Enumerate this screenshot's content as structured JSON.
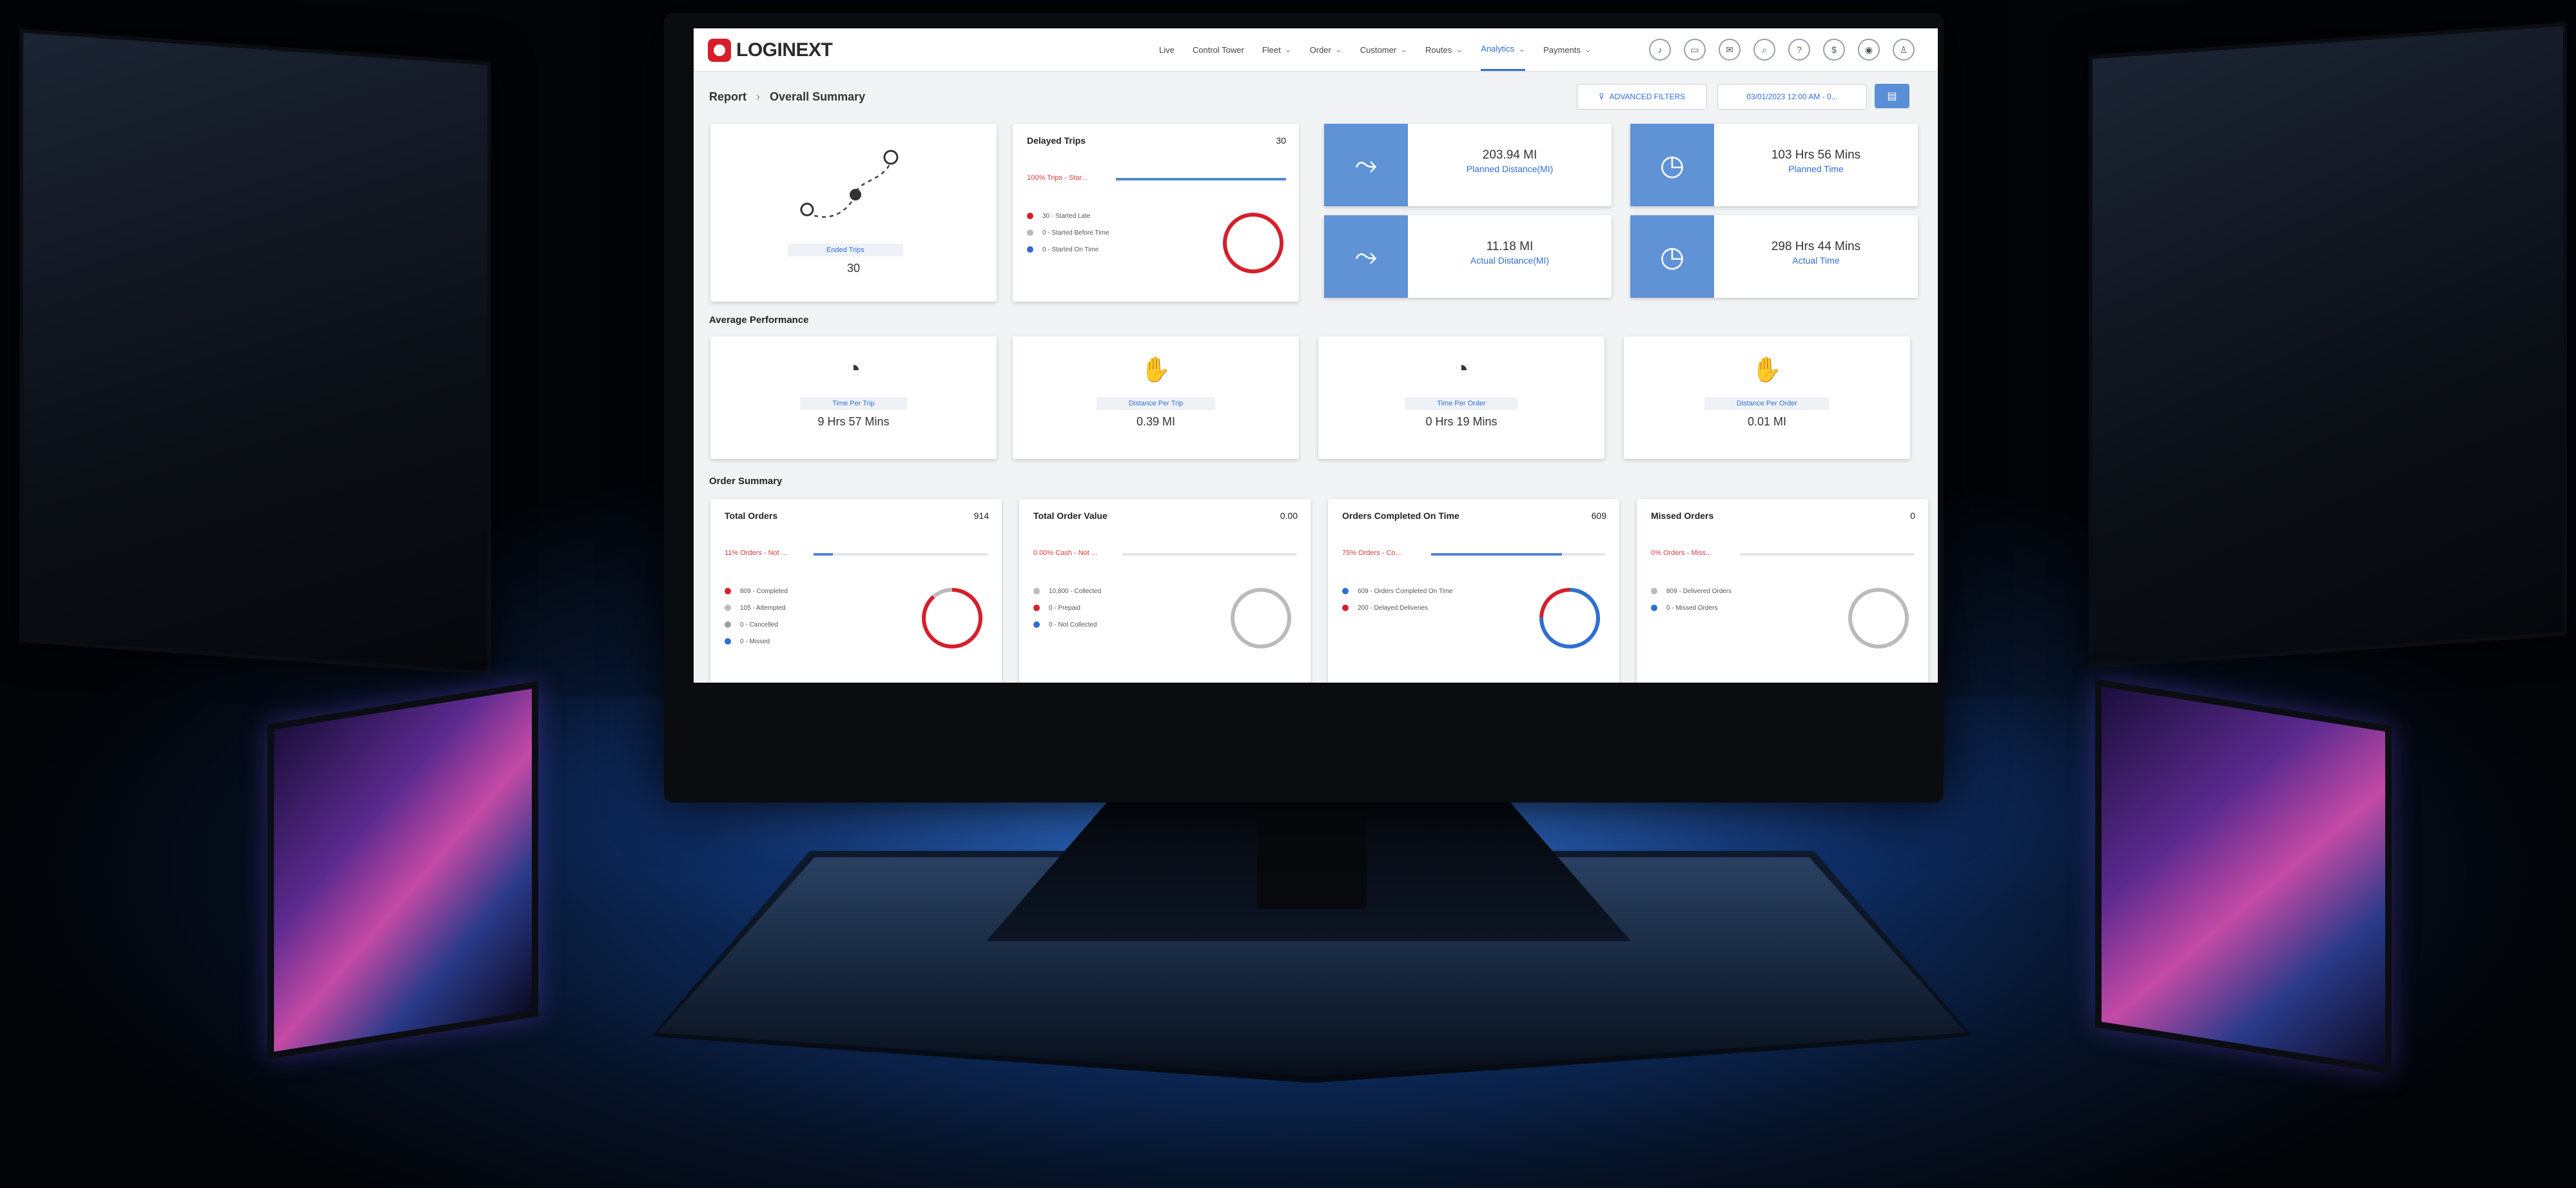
{
  "app": {
    "brand": "LOGINEXT"
  },
  "nav": {
    "items": [
      "Live",
      "Control Tower",
      "Fleet",
      "Order",
      "Customer",
      "Routes",
      "Analytics",
      "Payments"
    ],
    "chevron": "⌄",
    "active": "Analytics"
  },
  "nav_icons": [
    "bell-icon",
    "chat-icon",
    "mail-icon",
    "search-icon",
    "help-icon",
    "dollar-icon",
    "eye-icon",
    "user-tree-icon"
  ],
  "breadcrumb": {
    "root": "Report",
    "separator": "›",
    "current": "Overall Summary"
  },
  "filters": {
    "advanced": "ADVANCED FILTERS",
    "date_range": "03/01/2023 12:00 AM - 0..."
  },
  "trips": {
    "ended_label": "Ended Trips",
    "ended_value": "30"
  },
  "delayed_trips": {
    "title": "Delayed Trips",
    "count": "30",
    "pct_text": "100% Trips - Star...",
    "progress": 1.0,
    "legend": [
      {
        "text": "30 - Started Late",
        "color": "#d61f2b"
      },
      {
        "text": "0 - Started Before Time",
        "color": "#bbbbbb"
      },
      {
        "text": "0 - Started On Time",
        "color": "#2f6fd1"
      }
    ]
  },
  "metrics": [
    {
      "value": "203.94 MI",
      "label": "Planned Distance(MI)",
      "icon": "route-icon"
    },
    {
      "value": "103 Hrs 56 Mins",
      "label": "Planned Time",
      "icon": "clock-icon"
    },
    {
      "value": "11.18 MI",
      "label": "Actual Distance(MI)",
      "icon": "route-icon"
    },
    {
      "value": "298 Hrs 44 Mins",
      "label": "Actual Time",
      "icon": "clock-icon"
    }
  ],
  "average_performance": {
    "title": "Average Performance",
    "items": [
      {
        "label": "Time Per Trip",
        "value": "9 Hrs 57 Mins"
      },
      {
        "label": "Distance Per Trip",
        "value": "0.39 MI"
      },
      {
        "label": "Time Per Order",
        "value": "0 Hrs 19 Mins"
      },
      {
        "label": "Distance Per Order",
        "value": "0.01 MI"
      }
    ]
  },
  "order_summary": {
    "title": "Order Summary",
    "cards": [
      {
        "title": "Total Orders",
        "count": "914",
        "pct_text": "11% Orders - Not ...",
        "progress": 0.11,
        "legend": [
          {
            "text": "809 - Completed",
            "color": "#d61f2b"
          },
          {
            "text": "105 - Attempted",
            "color": "#bbbbbb"
          },
          {
            "text": "0 - Cancelled",
            "color": "#9aa0a8"
          },
          {
            "text": "0 - Missed",
            "color": "#2f6fd1"
          }
        ]
      },
      {
        "title": "Total Order Value",
        "count": "0.00",
        "pct_text": "0.00% Cash - Not ...",
        "progress": 0.0,
        "legend": [
          {
            "text": "10,800 - Collected",
            "color": "#bbbbbb"
          },
          {
            "text": "0 - Prepaid",
            "color": "#d61f2b"
          },
          {
            "text": "0 - Not Collected",
            "color": "#2f6fd1"
          }
        ]
      },
      {
        "title": "Orders Completed On Time",
        "count": "609",
        "pct_text": "75% Orders - Co...",
        "progress": 0.75,
        "legend": [
          {
            "text": "609 - Orders Completed On Time",
            "color": "#2f6fd1"
          },
          {
            "text": "200 - Delayed Deliveries",
            "color": "#d61f2b"
          }
        ]
      },
      {
        "title": "Missed Orders",
        "count": "0",
        "pct_text": "0% Orders - Miss...",
        "progress": 0.0,
        "legend": [
          {
            "text": "809 - Delivered Orders",
            "color": "#bbbbbb"
          },
          {
            "text": "0 - Missed Orders",
            "color": "#2f6fd1"
          }
        ]
      }
    ]
  }
}
